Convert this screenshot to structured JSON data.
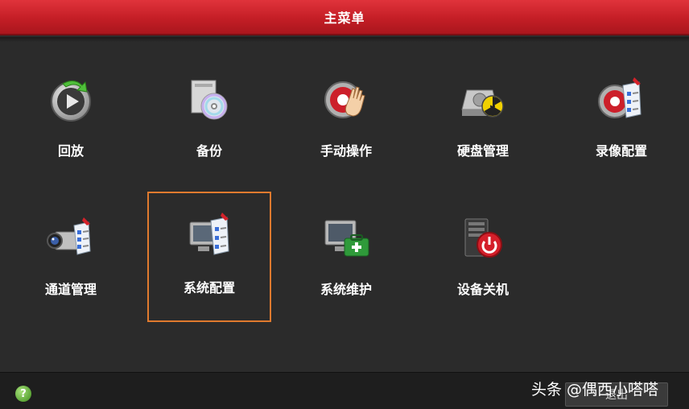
{
  "window": {
    "title": "主菜单"
  },
  "menu": {
    "items": [
      {
        "label": "回放",
        "icon": "playback-icon"
      },
      {
        "label": "备份",
        "icon": "backup-disc-icon"
      },
      {
        "label": "手动操作",
        "icon": "manual-operation-icon"
      },
      {
        "label": "硬盘管理",
        "icon": "hdd-management-icon"
      },
      {
        "label": "录像配置",
        "icon": "record-config-icon"
      },
      {
        "label": "通道管理",
        "icon": "camera-channel-icon"
      },
      {
        "label": "系统配置",
        "icon": "system-config-icon",
        "selected": true
      },
      {
        "label": "系统维护",
        "icon": "system-maintenance-icon"
      },
      {
        "label": "设备关机",
        "icon": "device-shutdown-icon"
      }
    ]
  },
  "statusbar": {
    "help_label": "?",
    "exit_label": "退出"
  },
  "watermark": "头条 @偶西小嗒嗒",
  "colors": {
    "title_red": "#c41e26",
    "selection_orange": "#e07a2e",
    "background": "#2b2b2b"
  }
}
